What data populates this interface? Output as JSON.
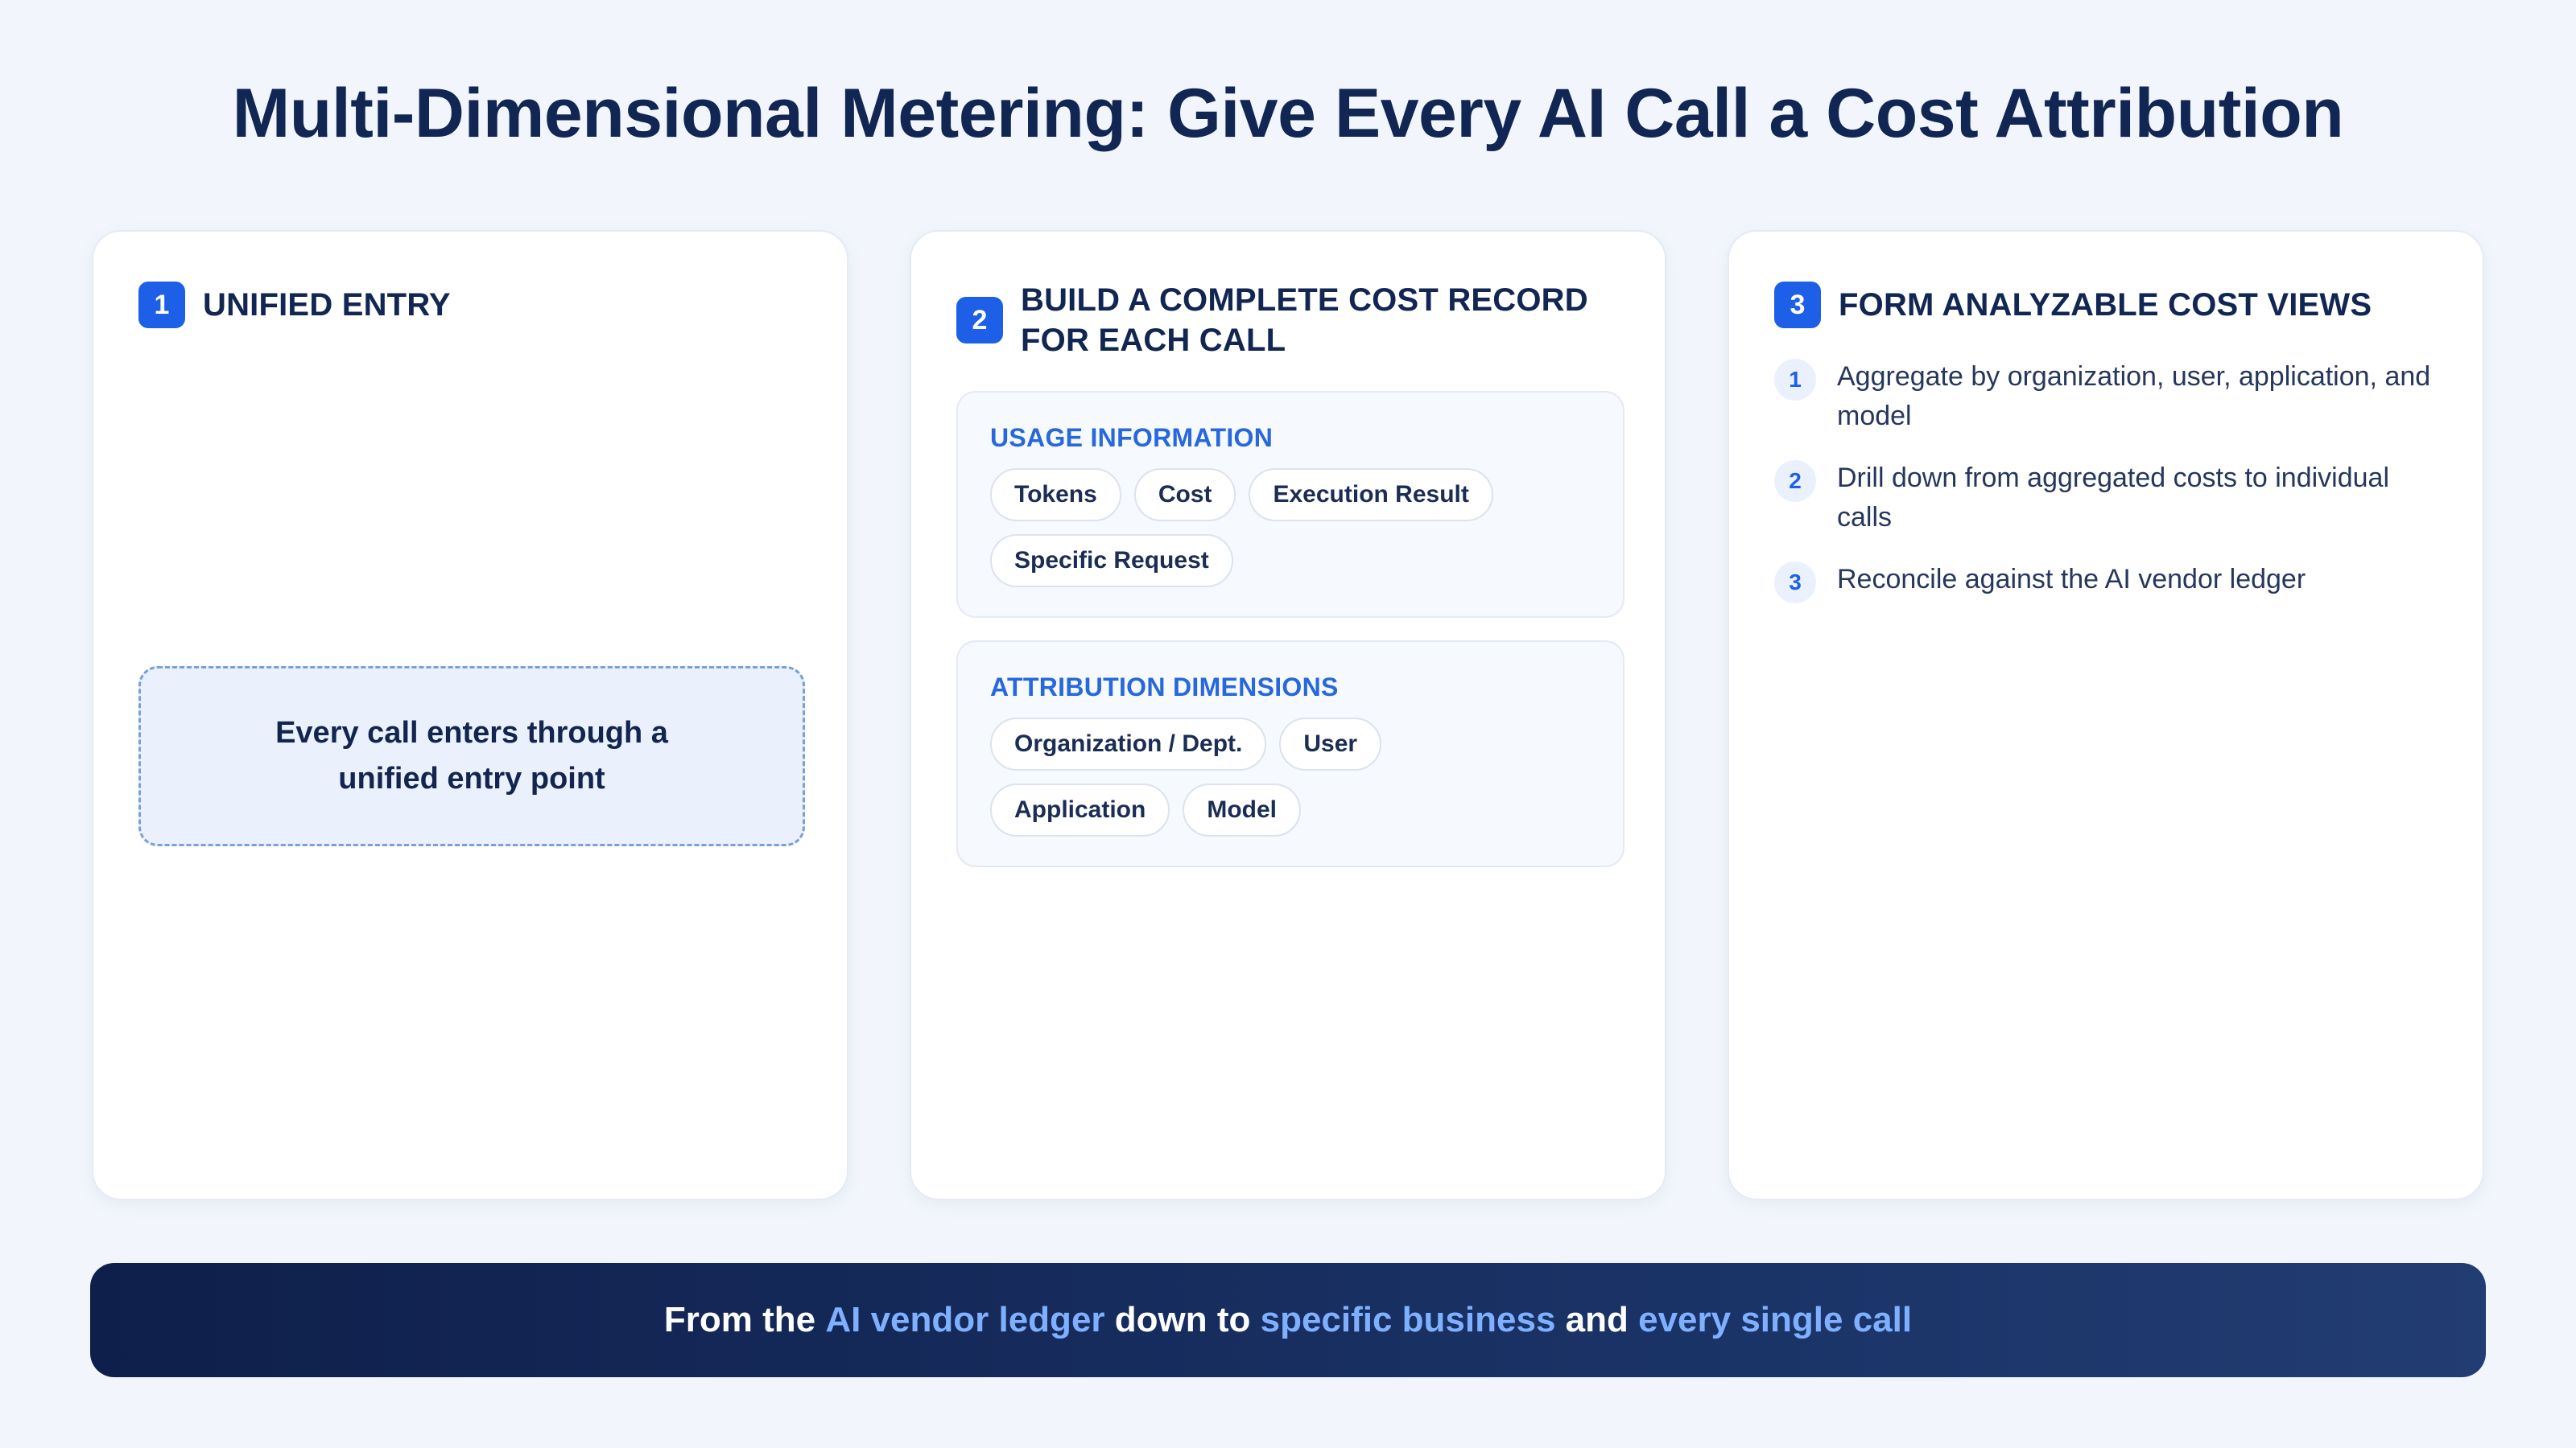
{
  "title": "Multi-Dimensional Metering: Give Every AI Call a Cost Attribution",
  "cards": [
    {
      "number": "1",
      "title": "UNIFIED ENTRY",
      "entry_text": "Every call enters through a unified entry point"
    },
    {
      "number": "2",
      "title": "BUILD A COMPLETE COST RECORD FOR EACH CALL",
      "sections": [
        {
          "label": "USAGE INFORMATION",
          "tags": [
            "Tokens",
            "Cost",
            "Execution Result",
            "Specific Request"
          ]
        },
        {
          "label": "ATTRIBUTION DIMENSIONS",
          "tags": [
            "Organization / Dept.",
            "User",
            "Application",
            "Model"
          ]
        }
      ]
    },
    {
      "number": "3",
      "title": "FORM ANALYZABLE COST VIEWS",
      "points": [
        {
          "num": "1",
          "text": "Aggregate by organization, user, application, and model"
        },
        {
          "num": "2",
          "text": "Drill down from aggregated costs to individual calls"
        },
        {
          "num": "3",
          "text": "Reconcile against the AI vendor ledger"
        }
      ]
    }
  ],
  "banner": {
    "p1": "From the ",
    "h1": "AI vendor ledger",
    "p2": " down to ",
    "h2": "specific business",
    "p3": " and ",
    "h3": "every single call"
  },
  "colors": {
    "accent": "#1d5fe6",
    "section_label": "#2768dc",
    "banner_highlight": "#7fb0ff",
    "banner_bg": "#13285a"
  }
}
